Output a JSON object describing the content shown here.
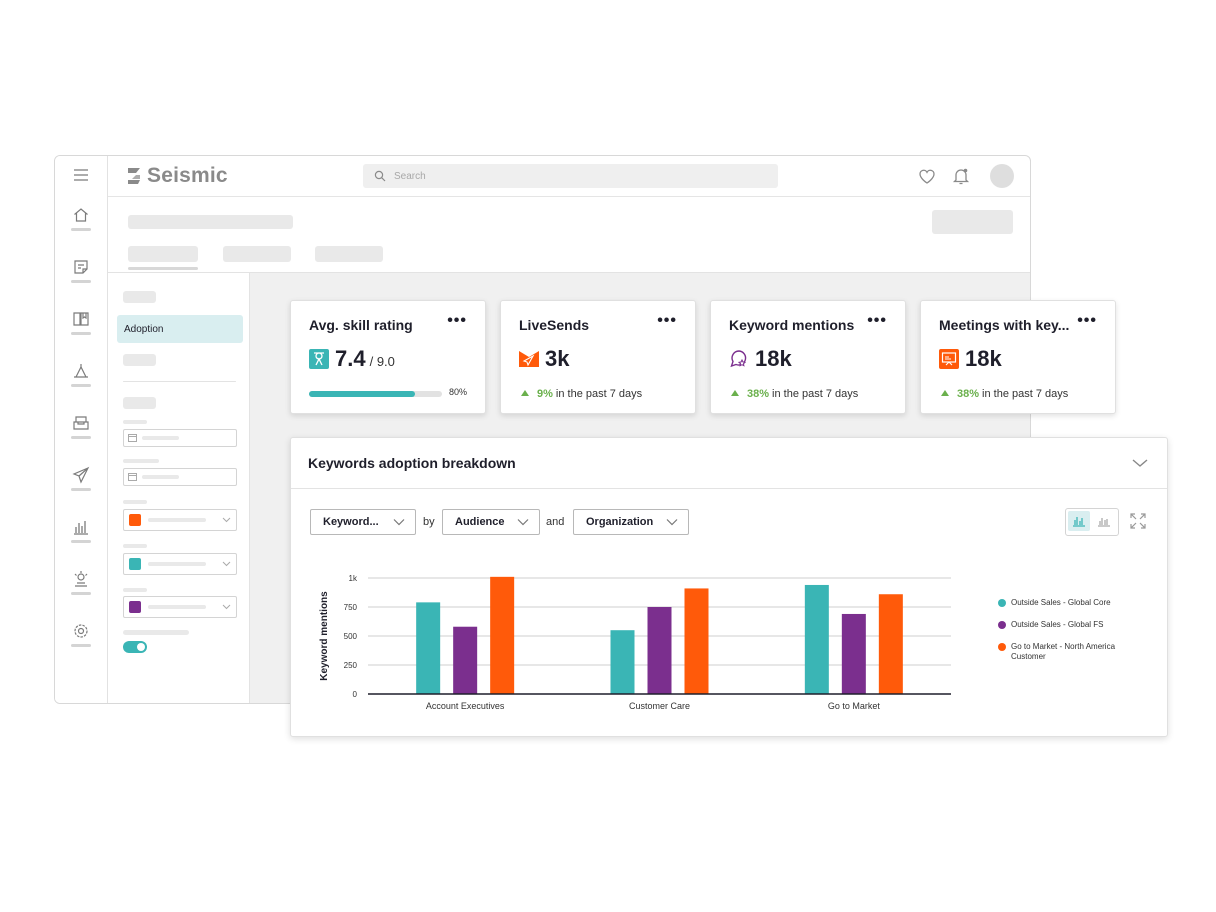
{
  "app": {
    "logo_text": "Seismic",
    "search_placeholder": "Search"
  },
  "sidebar": {
    "selected_item": "Adoption"
  },
  "colors": {
    "teal": "#3ab5b5",
    "purple": "#7b2f8e",
    "orange": "#ff5a0a",
    "positive": "#6ab04c"
  },
  "cards": [
    {
      "title": "Avg. skill rating",
      "icon": "skill-rating-icon",
      "value": "7.4",
      "total": "/ 9.0",
      "progress": 0.8,
      "progress_label": "80%"
    },
    {
      "title": "LiveSends",
      "icon": "livesend-icon",
      "value": "3k",
      "trend_pct": "9%",
      "trend_text": "in the past 7 days"
    },
    {
      "title": "Keyword mentions",
      "icon": "keyword-mentions-icon",
      "value": "18k",
      "trend_pct": "38%",
      "trend_text": "in the past 7 days"
    },
    {
      "title": "Meetings with key...",
      "icon": "meetings-icon",
      "value": "18k",
      "trend_pct": "38%",
      "trend_text": "in the past 7 days"
    }
  ],
  "breakdown": {
    "title": "Keywords adoption breakdown",
    "filter1": "Keyword...",
    "by": "by",
    "filter2": "Audience",
    "and": "and",
    "filter3": "Organization"
  },
  "chart_data": {
    "type": "bar",
    "ylabel": "Keyword mentions",
    "ylim": [
      0,
      1000
    ],
    "yticks": [
      0,
      250,
      500,
      750,
      1000
    ],
    "ytick_labels": [
      "0",
      "250",
      "500",
      "750",
      "1k"
    ],
    "categories": [
      "Account Executives",
      "Customer Care",
      "Go to Market"
    ],
    "series": [
      {
        "name": "Outside Sales - Global Core",
        "color": "#3ab5b5",
        "values": [
          790,
          550,
          940
        ]
      },
      {
        "name": "Outside Sales - Global FS",
        "color": "#7b2f8e",
        "values": [
          580,
          750,
          690
        ]
      },
      {
        "name": "Go to Market - North America Customer",
        "color": "#ff5a0a",
        "values": [
          1010,
          910,
          860
        ]
      }
    ],
    "grid": true,
    "legend": "right"
  }
}
